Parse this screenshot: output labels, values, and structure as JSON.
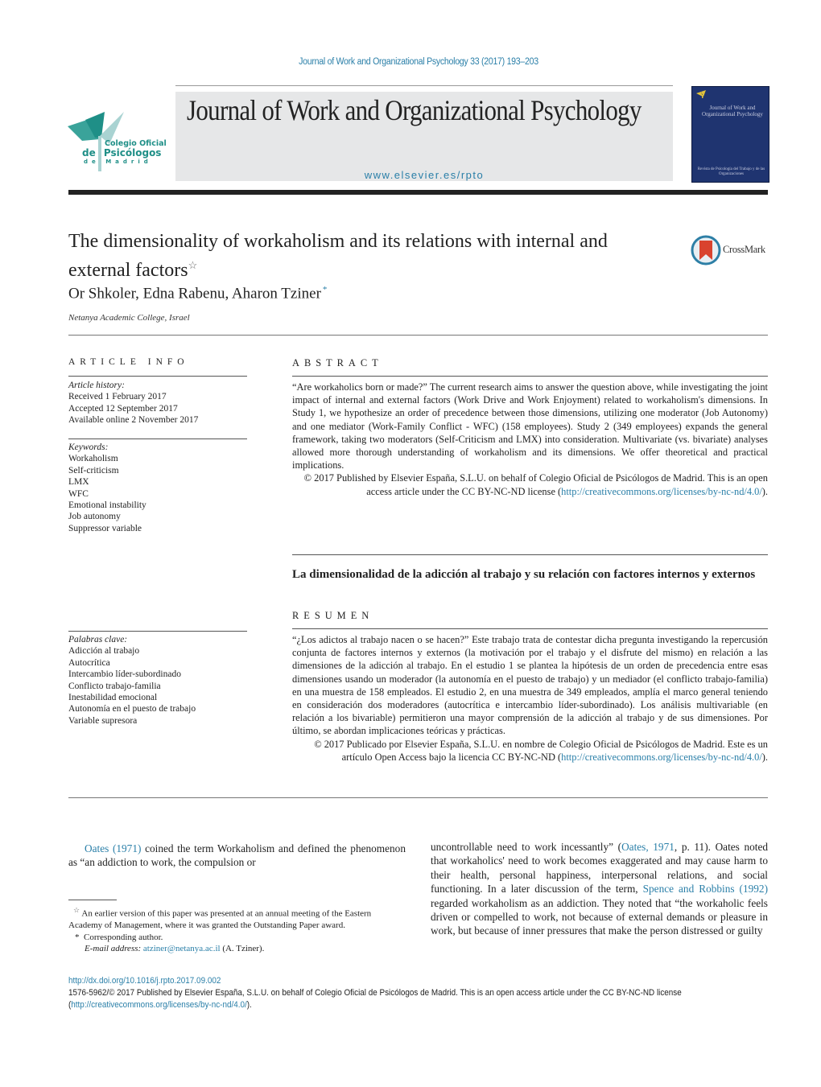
{
  "running_head": "Journal of Work and Organizational Psychology 33 (2017) 193–203",
  "masthead": {
    "society_logo": {
      "line1": "Colegio Oficial",
      "line2_a": "de",
      "line2_b": "Psicólogos",
      "line3": "de Madrid"
    },
    "journal_title": "Journal of Work and Organizational Psychology",
    "url": "www.elsevier.es/rpto",
    "cover": {
      "title": "Journal of Work and Organizational Psychology",
      "footer": "Revista de Psicología del Trabajo y de las Organizaciones"
    }
  },
  "article": {
    "title_line1": "The dimensionality of workaholism and its relations with internal and",
    "title_line2": "external factors",
    "title_mark": "☆",
    "crossmark_label": "CrossMark",
    "authors": "Or Shkoler,  Edna Rabenu, Aharon Tziner",
    "corresponding_mark": "*",
    "affiliation": "Netanya Academic College, Israel"
  },
  "article_info": {
    "heading": "ARTICLE INFO",
    "history_label": "Article history:",
    "history": [
      "Received 1 February 2017",
      "Accepted 12 September 2017",
      "Available online 2 November 2017"
    ],
    "keywords_label": "Keywords:",
    "keywords": [
      "Workaholism",
      "Self-criticism",
      "LMX",
      "WFC",
      "Emotional instability",
      "Job autonomy",
      "Suppressor variable"
    ],
    "palabras_label": "Palabras clave:",
    "palabras": [
      "Adicción al trabajo",
      "Autocrítica",
      "Intercambio líder-subordinado",
      "Conflicto trabajo-familia",
      "Inestabilidad emocional",
      "Autonomía en el puesto de trabajo",
      "Variable supresora"
    ]
  },
  "abstract": {
    "heading": "ABSTRACT",
    "text": "“Are workaholics born or made?” The current research aims to answer the question above, while investigating the joint impact of internal and external factors (Work Drive and Work Enjoyment) related to workaholism's dimensions. In Study 1, we hypothesize an order of precedence between those dimensions, utilizing one moderator (Job Autonomy) and one mediator (Work-Family Conflict - WFC) (158 employees). Study 2 (349 employees) expands the general framework, taking two moderators (Self-Criticism and LMX) into consideration. Multivariate (vs. bivariate) analyses allowed more thorough understanding of workaholism and its dimensions. We offer theoretical and practical implications.",
    "copyright_text": "© 2017 Published by Elsevier España, S.L.U. on behalf of Colegio Oficial de Psicólogos de Madrid. This is an open access article under the CC BY-NC-ND license (",
    "license_link": "http://creativecommons.org/licenses/by-nc-nd/4.0/",
    "copyright_end": ")."
  },
  "resumen": {
    "spanish_title": "La dimensionalidad de la adicción al trabajo y su relación con factores internos y externos",
    "heading": "RESUMEN",
    "text": "“¿Los adictos al trabajo nacen o se hacen?” Este trabajo trata de contestar dicha pregunta investigando la repercusión conjunta de factores internos y externos (la motivación por el trabajo y el disfrute del mismo) en relación a las dimensiones de la adicción al trabajo. En el estudio 1 se plantea la hipótesis de un orden de precedencia entre esas dimensiones usando un moderador (la autonomía en el puesto de trabajo) y un mediador (el conflicto trabajo-familia) en una muestra de 158 empleados. El estudio 2, en una muestra de 349 empleados, amplía el marco general teniendo en consideración dos moderadores (autocrítica e intercambio líder-subordinado). Los análisis multivariable (en relación a los bivariable) permitieron una mayor comprensión de la adicción al trabajo y de sus dimensiones. Por último, se abordan implicaciones teóricas y prácticas.",
    "copyright_text": "© 2017 Publicado por Elsevier España, S.L.U. en nombre de Colegio Oficial de Psicólogos de Madrid. Este es un artículo Open Access bajo la licencia CC BY-NC-ND (",
    "license_link": "http://creativecommons.org/licenses/by-nc-nd/4.0/",
    "copyright_end": ")."
  },
  "body": {
    "left_cite": "Oates (1971)",
    "left_text": " coined the term Workaholism and defined the phenomenon as “an addiction to work, the compulsion or",
    "right_text_1": "uncontrollable need to work incessantly” (",
    "right_cite_1": "Oates, 1971",
    "right_text_2": ", p. 11). Oates noted that workaholics' need to work becomes exaggerated and may cause harm to their health, personal happiness, interpersonal relations, and social functioning. In a later discussion of the term, ",
    "right_cite_2": "Spence and Robbins (1992)",
    "right_text_3": " regarded workaholism as an addiction. They noted that “the workaholic feels driven or compelled to work, not because of external demands or pleasure in work, but because of inner pressures that make the person distressed or guilty"
  },
  "footnotes": {
    "star_mark": "☆",
    "star_text": "An earlier version of this paper was presented at an annual meeting of the Eastern Academy of Management, where it was granted the Outstanding Paper award.",
    "corr_mark": "*",
    "corr_text": "Corresponding author.",
    "email_label": "E-mail address:",
    "email": "atziner@netanya.ac.il",
    "email_owner": "(A. Tziner)."
  },
  "bottom": {
    "doi": "http://dx.doi.org/10.1016/j.rpto.2017.09.002",
    "issn_line": "1576-5962/© 2017 Published by Elsevier España, S.L.U. on behalf of Colegio Oficial de Psicólogos de Madrid. This is an open access article under the CC BY-NC-ND license",
    "license_open": "(",
    "license_link": "http://creativecommons.org/licenses/by-nc-nd/4.0/",
    "license_close": ")."
  },
  "colors": {
    "link": "#2a7fa8",
    "cover": "#1f3470",
    "logo_teal": "#1f8f87",
    "logo_light": "#a9d3d2"
  }
}
